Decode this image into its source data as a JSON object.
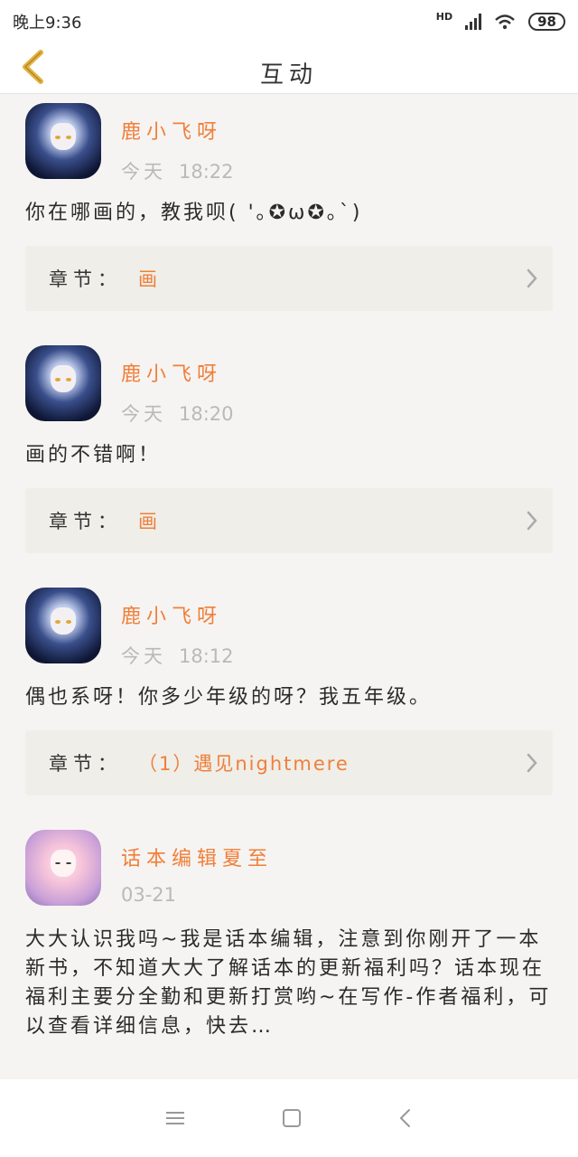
{
  "status_bar": {
    "time": "晚上9:36",
    "network": "HD",
    "battery": "98"
  },
  "header": {
    "title": "互动"
  },
  "items": [
    {
      "user": "鹿小飞呀",
      "day": "今天",
      "time": "18:22",
      "comment": "你在哪画的，教我呗( '｡✪ω✪｡`)",
      "chapter_label": "章节：",
      "chapter": "画"
    },
    {
      "user": "鹿小飞呀",
      "day": "今天",
      "time": "18:20",
      "comment": "画的不错啊！",
      "chapter_label": "章节：",
      "chapter": "画"
    },
    {
      "user": "鹿小飞呀",
      "day": "今天",
      "time": "18:12",
      "comment": "偶也系呀！你多少年级的呀？我五年级。",
      "chapter_label": "章节：",
      "chapter": "（1）遇见nightmere"
    },
    {
      "user": "话本编辑夏至",
      "day": "",
      "time": "03-21",
      "comment": "大大认识我吗~我是话本编辑，注意到你刚开了一本新书，不知道大大了解话本的更新福利吗？话本现在福利主要分全勤和更新打赏哟~在写作-作者福利，可以查看详细信息，快去…"
    }
  ],
  "icons": {
    "back": "chevron-left-icon",
    "chapter_arrow": "chevron-right-icon",
    "nav_menu": "menu-icon",
    "nav_home": "square-icon",
    "nav_back": "triangle-left-icon"
  },
  "colors": {
    "accent": "#f07f3a",
    "back_arrow": "#e3b23c",
    "background": "#f6f4f2"
  }
}
